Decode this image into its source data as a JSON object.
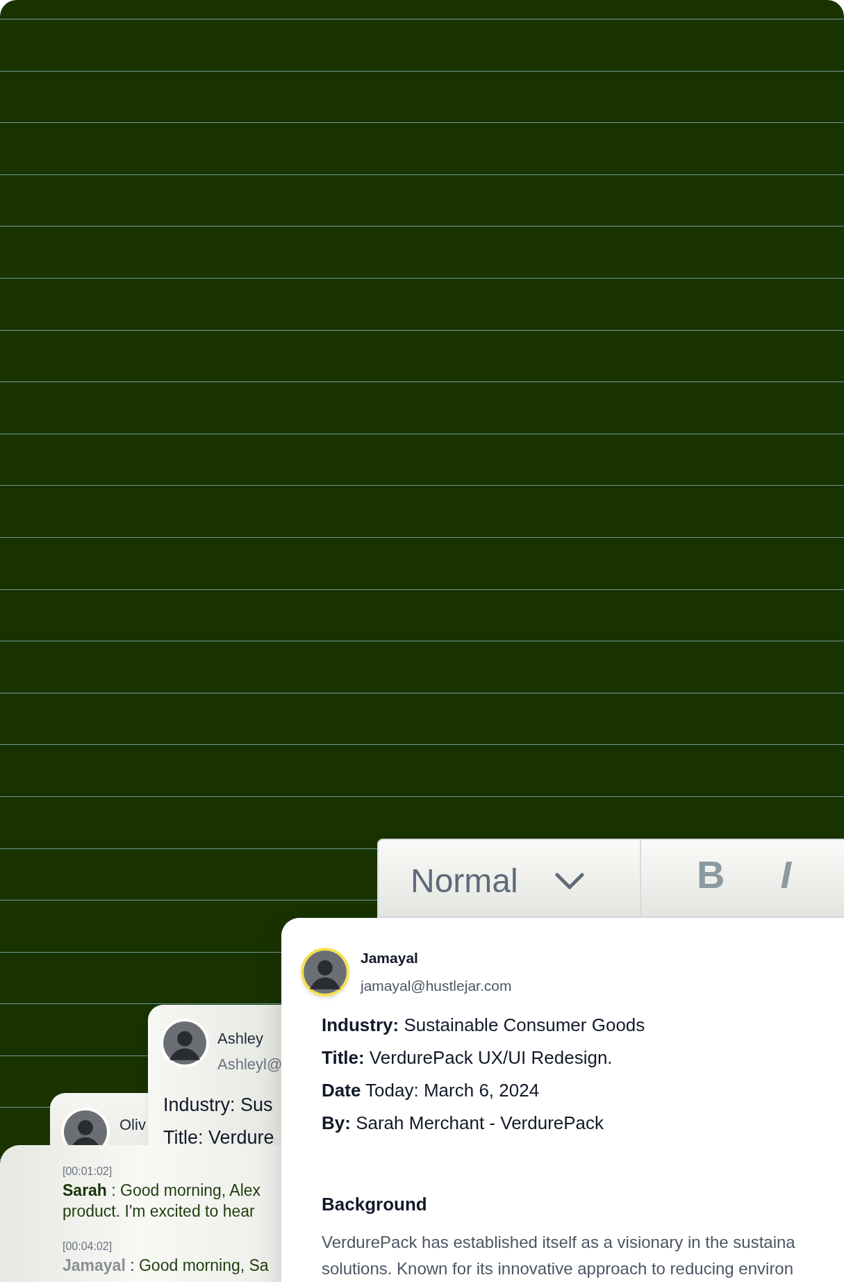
{
  "toolbar": {
    "style_select": "Normal",
    "bold_button": "B",
    "italic_button": "I"
  },
  "back_cards": [
    {
      "name": "Oliv"
    },
    {
      "name": "Ashley",
      "email": "Ashleyl@",
      "details": [
        "Industry: Sus",
        "Title: Verdure"
      ]
    }
  ],
  "main_card": {
    "name": "Jamayal",
    "email": "jamayal@hustlejar.com",
    "details": [
      "**Industry:** Sustainable Consumer Goods",
      "**Title:** VerdurePack UX/UI Redesign.",
      "**Date** Today: March 6, 2024",
      "**By:** Sarah Merchant - VerdurePack"
    ],
    "section_title": "Background",
    "paragraph_lines": [
      "VerdurePack has established itself as a visionary in the sustaina",
      "solutions. Known for its innovative approach to reducing environ"
    ]
  },
  "transcript": [
    {
      "time": "[00:01:02]",
      "speaker": "Sarah",
      "highlighted": true,
      "lines": [
        ": Good morning, Alex",
        "product. I'm excited to hear"
      ]
    },
    {
      "time": "[00:04:02]",
      "speaker": "Jamayal",
      "highlighted": false,
      "lines": [
        ": Good morning, Sa"
      ]
    }
  ]
}
